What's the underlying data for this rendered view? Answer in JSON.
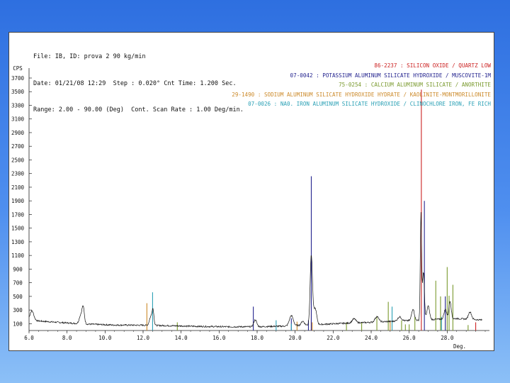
{
  "header": {
    "line1": "File: IB, ID: prova 2 90 kg/min",
    "line2": "Date: 01/21/08 12:29  Step : 0.020° Cnt Time: 1.200 Sec.",
    "line3": "Range: 2.00 - 90.00 (Deg)  Cont. Scan Rate : 1.00 Deg/min."
  },
  "chart_data": {
    "type": "line",
    "ylabel": "CPS",
    "xlabel": "Deg.",
    "xlim": [
      6.0,
      30.0
    ],
    "ylim": [
      0,
      3700
    ],
    "x_ticks": [
      "6.0",
      "8.0",
      "10.0",
      "12.0",
      "14.0",
      "16.0",
      "18.0",
      "20.0",
      "22.0",
      "24.0",
      "26.0",
      "28.0"
    ],
    "y_ticks": [
      "3700",
      "3500",
      "3300",
      "3100",
      "2900",
      "2700",
      "2500",
      "2300",
      "2100",
      "1900",
      "1700",
      "1500",
      "1300",
      "1100",
      "900",
      "700",
      "500",
      "300",
      "100"
    ],
    "pattern": {
      "baseline": [
        [
          6.0,
          150
        ],
        [
          7.5,
          120
        ],
        [
          9.0,
          95
        ],
        [
          10.5,
          80
        ],
        [
          12.0,
          78
        ],
        [
          13.5,
          70
        ],
        [
          15.0,
          60
        ],
        [
          16.5,
          55
        ],
        [
          18.0,
          55
        ],
        [
          19.5,
          65
        ],
        [
          21.0,
          85
        ],
        [
          22.5,
          105
        ],
        [
          24.0,
          120
        ],
        [
          25.5,
          140
        ],
        [
          26.5,
          150
        ],
        [
          27.5,
          165
        ],
        [
          28.5,
          175
        ],
        [
          29.8,
          155
        ]
      ],
      "peaks": [
        {
          "x": 6.15,
          "h": 140,
          "w": 0.1
        },
        {
          "x": 8.85,
          "h": 230,
          "w": 0.06
        },
        {
          "x": 8.72,
          "h": 120,
          "w": 0.08
        },
        {
          "x": 12.4,
          "h": 120,
          "w": 0.07
        },
        {
          "x": 12.52,
          "h": 220,
          "w": 0.05
        },
        {
          "x": 17.9,
          "h": 100,
          "w": 0.08
        },
        {
          "x": 19.8,
          "h": 150,
          "w": 0.1
        },
        {
          "x": 20.4,
          "h": 60,
          "w": 0.08
        },
        {
          "x": 20.85,
          "h": 1020,
          "w": 0.06
        },
        {
          "x": 21.05,
          "h": 240,
          "w": 0.08
        },
        {
          "x": 23.1,
          "h": 60,
          "w": 0.1
        },
        {
          "x": 24.3,
          "h": 80,
          "w": 0.1
        },
        {
          "x": 25.5,
          "h": 60,
          "w": 0.1
        },
        {
          "x": 26.2,
          "h": 170,
          "w": 0.07
        },
        {
          "x": 26.62,
          "h": 1550,
          "w": 0.035
        },
        {
          "x": 26.75,
          "h": 700,
          "w": 0.05
        },
        {
          "x": 27.0,
          "h": 200,
          "w": 0.07
        },
        {
          "x": 27.9,
          "h": 140,
          "w": 0.07
        },
        {
          "x": 28.15,
          "h": 260,
          "w": 0.06
        },
        {
          "x": 29.2,
          "h": 110,
          "w": 0.08
        }
      ]
    },
    "reference_patterns": [
      {
        "label": "86-2237 : SILICON OXIDE / QUARTZ LOW",
        "color": "#cc2222",
        "lines": [
          [
            20.85,
            350
          ],
          [
            26.64,
            3530
          ],
          [
            29.5,
            120
          ]
        ]
      },
      {
        "label": "07-0042 : POTASSIUM ALUMINUM SILICATE HYDROXIDE / MUSCOVITE-1M",
        "color": "#24248f",
        "lines": [
          [
            17.8,
            350
          ],
          [
            19.8,
            180
          ],
          [
            20.7,
            150
          ],
          [
            20.85,
            2260
          ],
          [
            26.8,
            1900
          ],
          [
            27.9,
            500
          ]
        ]
      },
      {
        "label": "75-0254 : CALCIUM ALUMINUM SILICATE / ANORTHITE",
        "color": "#7a9a2e",
        "lines": [
          [
            13.8,
            120
          ],
          [
            22.7,
            120
          ],
          [
            23.5,
            120
          ],
          [
            24.3,
            210
          ],
          [
            24.9,
            420
          ],
          [
            25.6,
            150
          ],
          [
            25.8,
            90
          ],
          [
            26.0,
            90
          ],
          [
            26.3,
            200
          ],
          [
            27.4,
            730
          ],
          [
            27.65,
            500
          ],
          [
            28.0,
            930
          ],
          [
            28.1,
            510
          ],
          [
            28.3,
            670
          ],
          [
            29.1,
            80
          ]
        ]
      },
      {
        "label": "29-1490 : SODIUM ALUMINUM SILICATE HYDROXIDE HYDRATE / KAOLINITE-MONTMORILLONITE",
        "color": "#cc8a2a",
        "lines": [
          [
            12.2,
            400
          ],
          [
            20.1,
            130
          ],
          [
            20.9,
            120
          ],
          [
            25.0,
            140
          ]
        ]
      },
      {
        "label": "07-0026 : NA0. IRON ALUMINUM SILICATE HYDROXIDE / CLINOCHLORE IRON, FE RICH",
        "color": "#2aa0b5",
        "lines": [
          [
            12.5,
            560
          ],
          [
            19.0,
            150
          ],
          [
            19.8,
            100
          ],
          [
            25.1,
            350
          ],
          [
            27.7,
            200
          ]
        ]
      }
    ]
  }
}
